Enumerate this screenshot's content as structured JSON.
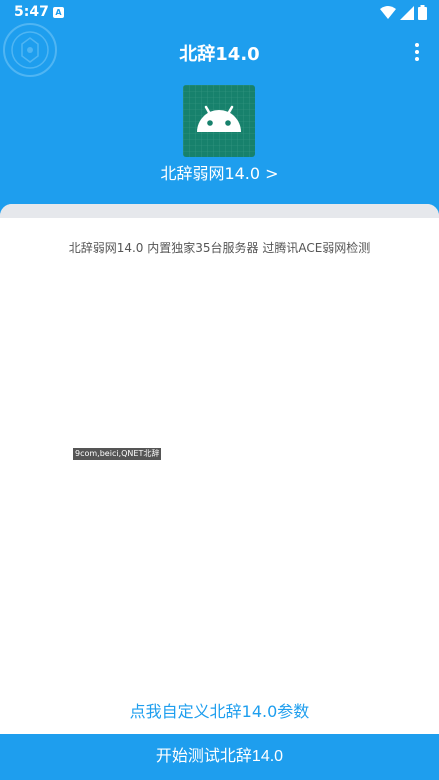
{
  "status_bar": {
    "time": "5:47",
    "notification_glyph": "A",
    "icons": [
      "wifi-icon",
      "signal-icon",
      "battery-icon"
    ]
  },
  "header": {
    "title": "北辞14.0",
    "menu_icon": "more-vert-icon"
  },
  "app": {
    "name": "北辞弱网14.0 >",
    "icon": "android-icon"
  },
  "content": {
    "description": "北辞弱网14.0 内置独家35台服务器 过腾讯ACE弱网检测",
    "tag": "9com,beici,QNET北辞"
  },
  "actions": {
    "customize_label": "点我自定义北辞14.0参数",
    "start_label": "开始测试北辞14.0"
  },
  "colors": {
    "primary": "#1E9EEE",
    "icon_bg": "#17816C",
    "text": "#555555"
  }
}
